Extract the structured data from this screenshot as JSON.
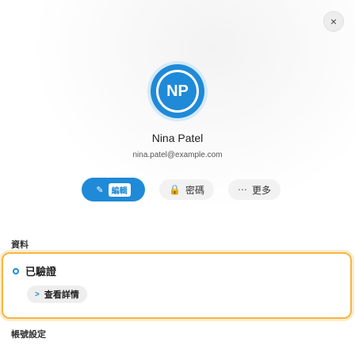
{
  "dialog": {
    "close_glyph": "×"
  },
  "profile": {
    "initials": "NP",
    "name": "Nina Patel",
    "email": "nina.patel@example.com"
  },
  "actions": {
    "edit": {
      "icon": "✎",
      "label": "編輯"
    },
    "lock": {
      "icon": "🔒",
      "label": "密碼"
    },
    "more": {
      "icon": "⋯",
      "label": "更多"
    }
  },
  "sections": {
    "first_label": "資料",
    "row_label": "已驗證",
    "sub_label": "查看詳情",
    "second_label": "帳號設定"
  },
  "colors": {
    "accent": "#1f8ad8",
    "focus": "#f3b646"
  }
}
